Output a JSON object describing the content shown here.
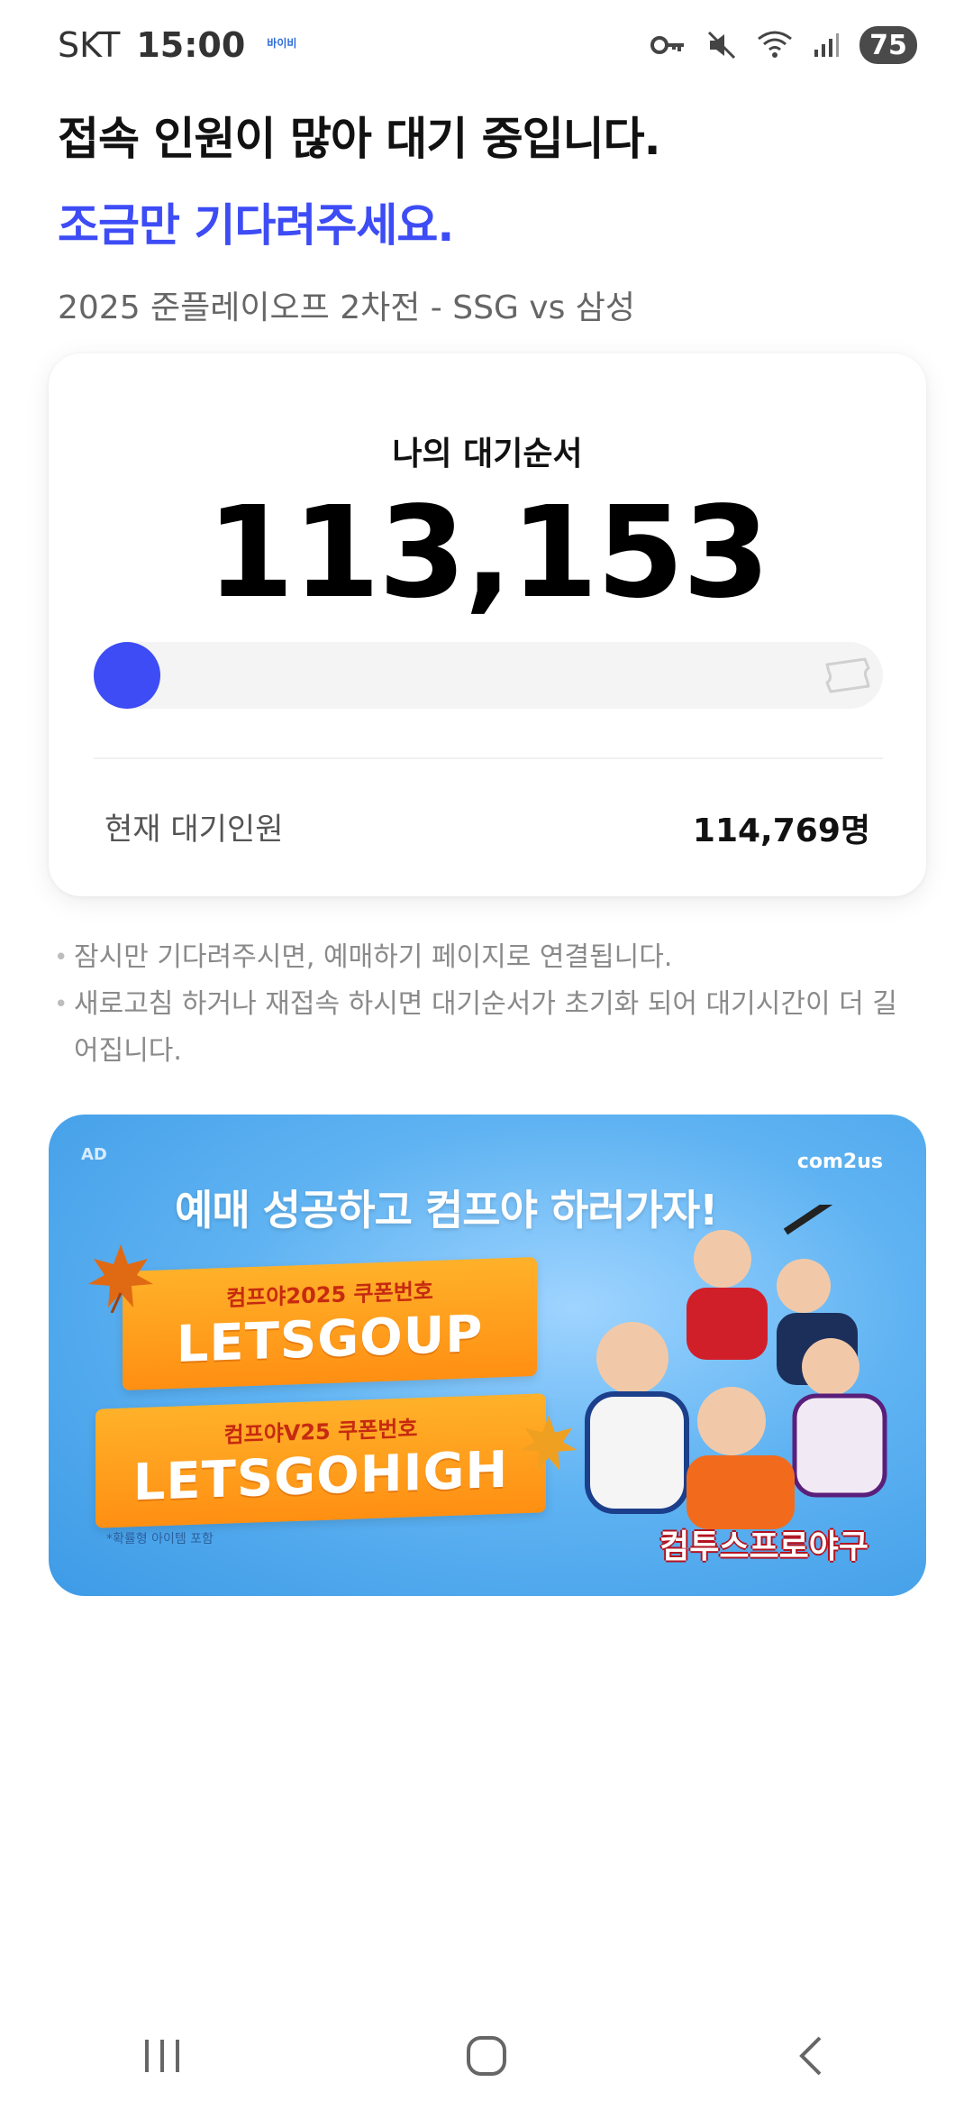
{
  "status_bar": {
    "carrier": "SKT",
    "time": "15:00",
    "mini_badge": "바이비",
    "battery": "75"
  },
  "header": {
    "title_line1": "접속 인원이 많아 대기 중입니다.",
    "title_line2": "조금만 기다려주세요.",
    "subtitle": "2025 준플레이오프 2차전 - SSG vs 삼성"
  },
  "queue": {
    "label": "나의 대기순서",
    "position": "113,153",
    "current_label": "현재 대기인원",
    "current_value": "114,769명"
  },
  "notices": [
    "잠시만 기다려주시면, 예매하기 페이지로 연결됩니다.",
    "새로고침 하거나 재접속 하시면 대기순서가 초기화 되어 대기시간이 더 길어집니다."
  ],
  "ad": {
    "tag": "AD",
    "brand": "com2us",
    "headline": "예매 성공하고 컴프야 하러가자!",
    "coupon1_sub": "컴프야2025 쿠폰번호",
    "coupon1_code": "LETSGOUP",
    "coupon2_sub": "컴프야V25 쿠폰번호",
    "coupon2_code": "LETSGOHIGH",
    "note": "*확률형 아이템 포함",
    "game_logo": "컴투스프로야구"
  },
  "colors": {
    "accent": "#3d4cf5",
    "track": "#f4f4f4"
  },
  "icons": {
    "key": "key-icon",
    "mute": "mute-icon",
    "wifi": "wifi-icon",
    "signal": "signal-icon",
    "ticket": "ticket-icon"
  }
}
